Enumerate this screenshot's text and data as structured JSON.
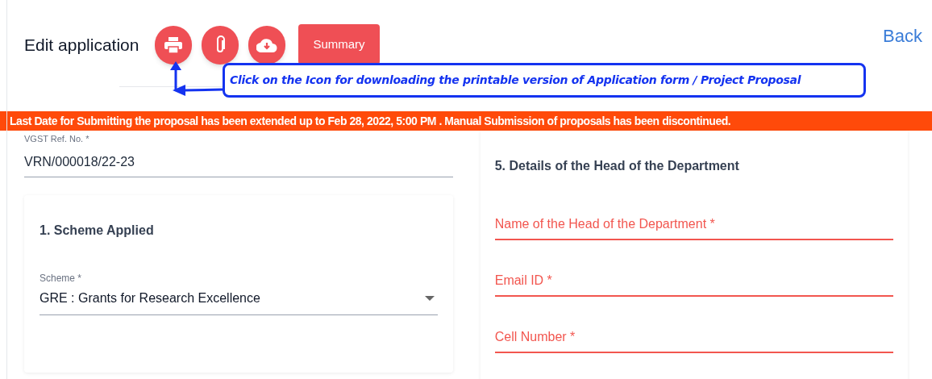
{
  "header": {
    "title": "Edit application",
    "icon_buttons": [
      {
        "kind": "print"
      },
      {
        "kind": "attach"
      },
      {
        "kind": "download"
      }
    ],
    "summary_button": "Summary",
    "back_link": "Back"
  },
  "callout": "Click on the Icon for downloading the printable version of Application form / Project Proposal",
  "banner": "Last Date for Submitting the proposal has been extended up to Feb 28, 2022, 5:00 PM . Manual Submission of proposals has been discontinued.",
  "ref_field": {
    "label": "VGST Ref. No. *",
    "value": "VRN/000018/22-23"
  },
  "scheme_card": {
    "heading": "1. Scheme Applied",
    "field": {
      "label": "Scheme *",
      "value": "GRE : Grants for Research Excellence"
    }
  },
  "hod_card": {
    "heading": "5. Details of the Head of the Department",
    "fields": [
      {
        "placeholder": "Name of the Head of the Department *",
        "invalid": true
      },
      {
        "placeholder": "Email ID *",
        "invalid": true
      },
      {
        "placeholder": "Cell Number *",
        "invalid": true
      }
    ]
  }
}
